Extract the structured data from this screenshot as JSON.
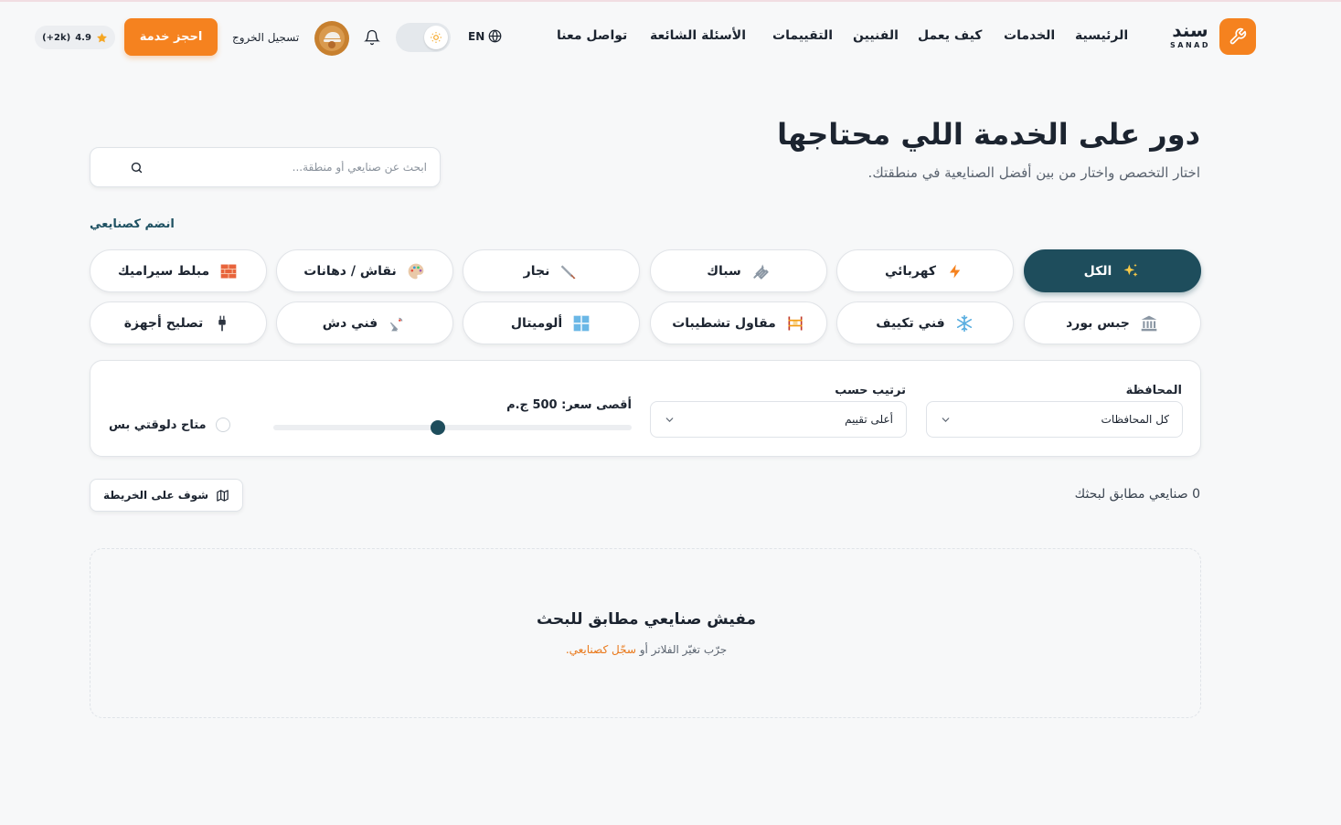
{
  "brand": {
    "name_ar": "سند",
    "name_en": "SANAD",
    "accent": "#f5821f",
    "primary": "#1e4d5c"
  },
  "nav": {
    "links": [
      "الرئيسية",
      "الخدمات",
      "كيف يعمل",
      "الفنيين",
      "التقييمات",
      "الأسئلة الشائعة",
      "تواصل معنا"
    ],
    "lang": "EN",
    "logout": "تسجيل الخروج",
    "book": "احجز خدمة",
    "rating": "4.9",
    "rating_count": "(+2k)"
  },
  "hero": {
    "title": "دور على الخدمة اللي محتاجها",
    "subtitle": "اختار التخصص واختار من بين أفضل الصنايعية في منطقتك.",
    "search_placeholder": "ابحث عن صنايعي أو منطقة...",
    "join": "انضم كصنايعي"
  },
  "categories": [
    {
      "label": "الكل",
      "icon": "sparkles-icon",
      "active": true
    },
    {
      "label": "كهربائي",
      "icon": "lightning-icon",
      "active": false
    },
    {
      "label": "سباك",
      "icon": "wrench-icon",
      "active": false
    },
    {
      "label": "نجار",
      "icon": "saw-icon",
      "active": false
    },
    {
      "label": "نقاش / دهانات",
      "icon": "palette-icon",
      "active": false
    },
    {
      "label": "مبلط سيراميك",
      "icon": "bricks-icon",
      "active": false
    },
    {
      "label": "جبس بورد",
      "icon": "building-icon",
      "active": false
    },
    {
      "label": "فني تكييف",
      "icon": "snowflake-icon",
      "active": false
    },
    {
      "label": "مقاول تشطيبات",
      "icon": "scaffold-icon",
      "active": false
    },
    {
      "label": "ألوميتال",
      "icon": "window-icon",
      "active": false
    },
    {
      "label": "فني دش",
      "icon": "satellite-icon",
      "active": false
    },
    {
      "label": "تصليح أجهزة",
      "icon": "plug-icon",
      "active": false
    }
  ],
  "filters": {
    "governorate_label": "المحافظة",
    "governorate_value": "كل المحافظات",
    "sort_label": "ترتيب حسب",
    "sort_value": "أعلى تقييم",
    "price_label": "أقصى سعر: 500 ج.م",
    "price_fraction": 0.46,
    "available_label": "متاح دلوقتي بس"
  },
  "results": {
    "count_text": "0 صنايعي مطابق لبحثك",
    "map_button": "شوف على الخريطة",
    "empty_title": "مفيش صنايعي مطابق للبحث",
    "empty_sub": "جرّب تغيّر الفلاتر أو",
    "empty_link": "سجّل كصنايعي."
  }
}
